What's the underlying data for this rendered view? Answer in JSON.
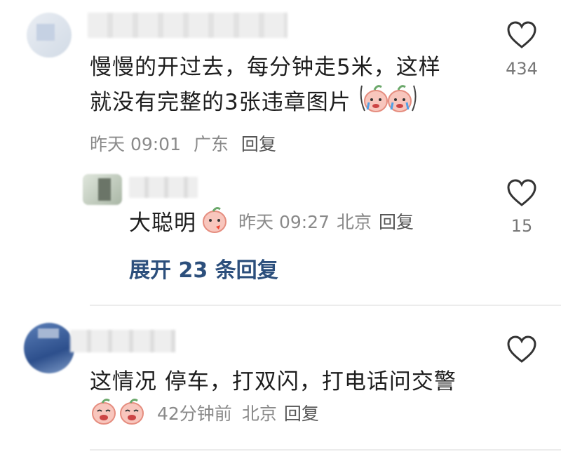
{
  "comments": [
    {
      "text_line1": "慢慢的开过去，每分钟走5米，这样",
      "text_line2": "就没有完整的3张违章图片",
      "time": "昨天 09:01",
      "location": "广东",
      "reply_label": "回复",
      "like_count": "434",
      "replies": [
        {
          "text": "大聪明",
          "time": "昨天 09:27",
          "location": "北京",
          "reply_label": "回复",
          "like_count": "15"
        }
      ],
      "expand_label": "展开 23 条回复"
    },
    {
      "text_line1": "这情况 停车，打双闪，打电话问交警",
      "time": "42分钟前",
      "location": "北京",
      "reply_label": "回复"
    }
  ],
  "icons": {
    "like": "heart-outline-icon",
    "emoji": "peach-face-emoji"
  },
  "colors": {
    "meta_text": "#8a8a8a",
    "expand_link": "#2c4f7c",
    "divider": "#ececec"
  }
}
